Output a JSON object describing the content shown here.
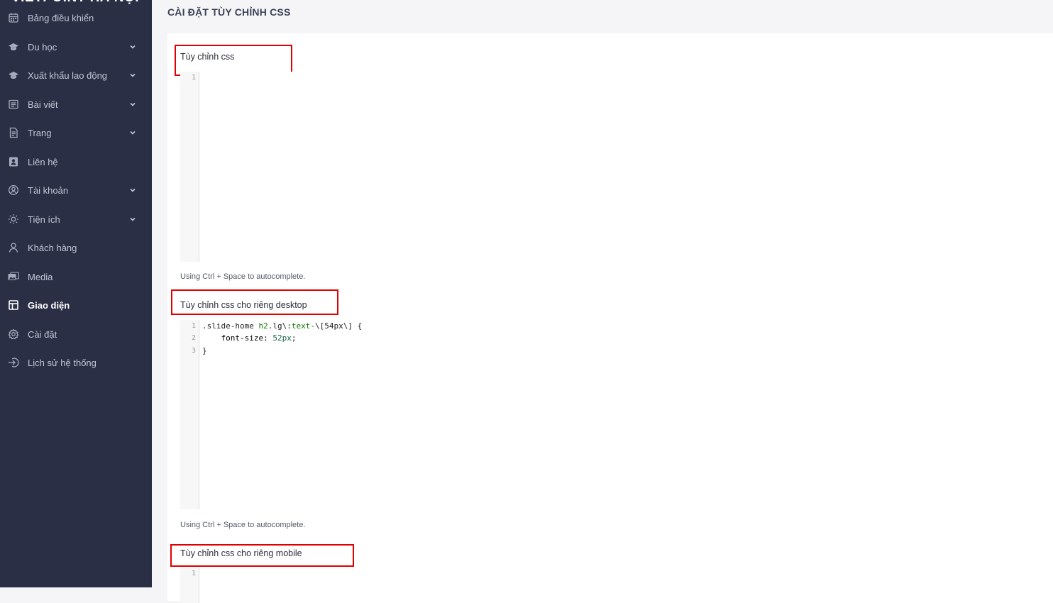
{
  "sidebar": {
    "brand": "VIETPOINT HÀ NỘI",
    "items": [
      {
        "label": "Bảng điều khiển",
        "icon": "calendar-icon",
        "has_children": false
      },
      {
        "label": "Du học",
        "icon": "graduation-cap-icon",
        "has_children": true
      },
      {
        "label": "Xuất khẩu lao động",
        "icon": "graduation-cap-icon",
        "has_children": true
      },
      {
        "label": "Bài viết",
        "icon": "article-icon",
        "has_children": true
      },
      {
        "label": "Trang",
        "icon": "file-icon",
        "has_children": true
      },
      {
        "label": "Liên hệ",
        "icon": "contact-icon",
        "has_children": false
      },
      {
        "label": "Tài khoản",
        "icon": "user-circle-icon",
        "has_children": true
      },
      {
        "label": "Tiện ích",
        "icon": "sun-icon",
        "has_children": true
      },
      {
        "label": "Khách hàng",
        "icon": "user-icon",
        "has_children": false
      },
      {
        "label": "Media",
        "icon": "media-icon",
        "has_children": false
      },
      {
        "label": "Giao diện",
        "icon": "layout-icon",
        "has_children": false,
        "active": true
      },
      {
        "label": "Cài đặt",
        "icon": "gear-icon",
        "has_children": false
      },
      {
        "label": "Lịch sử hệ thống",
        "icon": "login-icon",
        "has_children": false
      }
    ]
  },
  "page": {
    "title": "CÀI ĐẶT TÙY CHỈNH CSS"
  },
  "editors": [
    {
      "label": "Tùy chỉnh css",
      "hint": "Using Ctrl + Space to autocomplete.",
      "line_numbers": [
        "1"
      ],
      "lines": []
    },
    {
      "label": "Tùy chỉnh css cho riêng desktop",
      "hint": "Using Ctrl + Space to autocomplete.",
      "line_numbers": [
        "1",
        "2",
        "3"
      ],
      "lines": [
        {
          "selector": ".slide-home ",
          "tag": "h2",
          "cls": ".lg\\:",
          "attr": "text-",
          "rest": "\\[54px\\] {"
        },
        {
          "prop": "    font-size: ",
          "num": "52px",
          "end": ";"
        },
        {
          "plain": "}"
        }
      ]
    },
    {
      "label": "Tùy chỉnh css cho riêng mobile",
      "hint": "",
      "line_numbers": [
        "1"
      ],
      "lines": []
    }
  ]
}
